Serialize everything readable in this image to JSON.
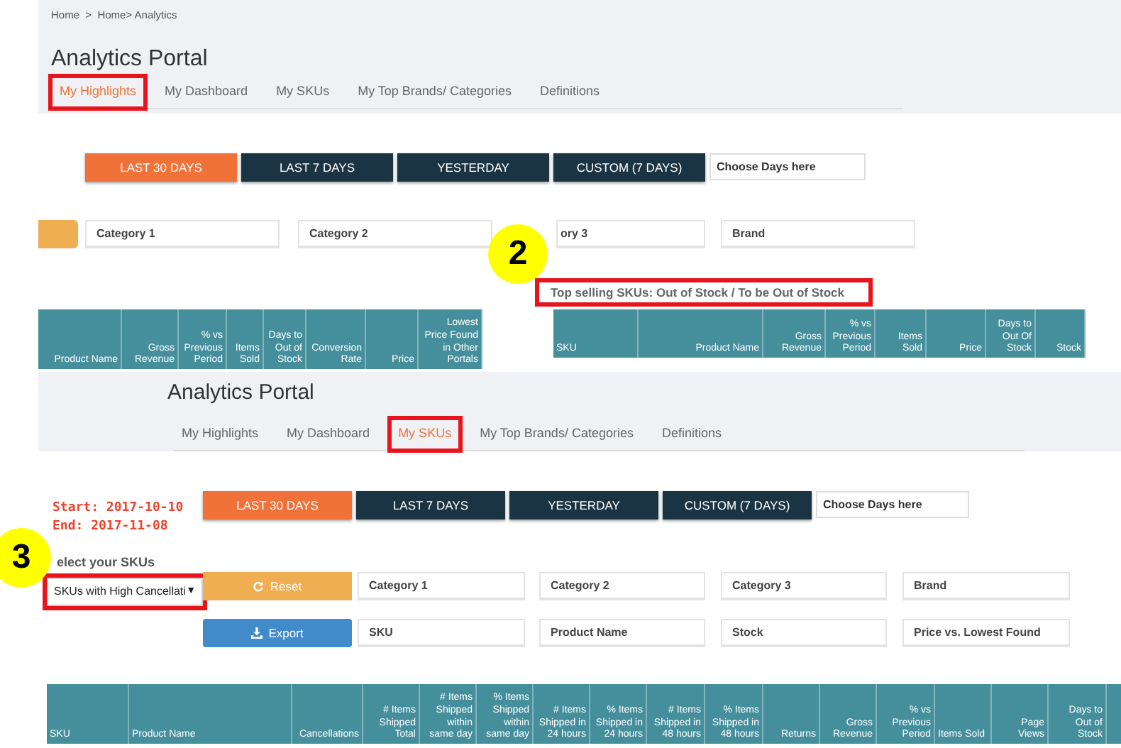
{
  "highlights_view": {
    "breadcrumb": "Home  >  Home> Analytics",
    "title": "Analytics Portal",
    "tabs": [
      {
        "label": "My Highlights",
        "selected": true,
        "annotated": true
      },
      {
        "label": "My Dashboard",
        "selected": false,
        "annotated": false
      },
      {
        "label": "My SKUs",
        "selected": false,
        "annotated": false
      },
      {
        "label": "My Top Brands/ Categories",
        "selected": false,
        "annotated": false
      },
      {
        "label": "Definitions",
        "selected": false,
        "annotated": false
      }
    ],
    "period_buttons": [
      {
        "label": "LAST 30 DAYS",
        "selected": true
      },
      {
        "label": "LAST 7 DAYS",
        "selected": false
      },
      {
        "label": "YESTERDAY",
        "selected": false
      },
      {
        "label": "CUSTOM (7 DAYS)",
        "selected": false
      }
    ],
    "days_field": {
      "placeholder": "Choose Days here"
    },
    "filters": [
      "Category 1",
      "Category 2",
      "ory 3",
      "Brand"
    ],
    "section_heading": {
      "text": "Top selling SKUs: Out of Stock / To be Out of Stock",
      "annotated": true
    },
    "table_left": {
      "columns": [
        "Product Name",
        "Gross Revenue",
        "% vs Previous Period",
        "Items Sold",
        "Days to Out of Stock",
        "Conversion Rate",
        "Price",
        "Lowest Price Found in Other Portals"
      ]
    },
    "table_right": {
      "columns": [
        "SKU",
        "Product Name",
        "Gross Revenue",
        "% vs Previous Period",
        "Items Sold",
        "Price",
        "Days to Out Of Stock",
        "Stock"
      ]
    }
  },
  "skus_view": {
    "title": "Analytics Portal",
    "tabs": [
      {
        "label": "My Highlights",
        "selected": false,
        "annotated": false
      },
      {
        "label": "My Dashboard",
        "selected": false,
        "annotated": false
      },
      {
        "label": "My SKUs",
        "selected": true,
        "annotated": true
      },
      {
        "label": "My Top Brands/ Categories",
        "selected": false,
        "annotated": false
      },
      {
        "label": "Definitions",
        "selected": false,
        "annotated": false
      }
    ],
    "date_range": [
      "Start: 2017-10-10",
      "End: 2017-11-08"
    ],
    "period_buttons": [
      {
        "label": "LAST 30 DAYS",
        "selected": true
      },
      {
        "label": "LAST 7 DAYS",
        "selected": false
      },
      {
        "label": "YESTERDAY",
        "selected": false
      },
      {
        "label": "CUSTOM (7 DAYS)",
        "selected": false
      }
    ],
    "days_field": {
      "placeholder": "Choose Days here"
    },
    "sku_select": {
      "label": "elect your SKUs",
      "value": "SKUs with High Cancellati",
      "caret": "▼",
      "annotated": true
    },
    "reset_button": {
      "label": "Reset"
    },
    "filters": [
      "Category 1",
      "Category 2",
      "Category 3",
      "Brand"
    ],
    "export_button": {
      "label": "Export"
    },
    "search_fields": [
      "SKU",
      "Product Name",
      "Stock",
      "Price vs. Lowest Found"
    ],
    "table": {
      "columns": [
        "SKU",
        "Product Name",
        "Cancellations",
        "# Items Shipped Total",
        "# Items Shipped within same day",
        "% Items Shipped within same day",
        "# Items Shipped in 24 hours",
        "% Items Shipped in 24 hours",
        "# Items Shipped in 48 hours",
        "% Items Shipped in 48 hours",
        "Returns",
        "Gross Revenue",
        "% vs Previous Period",
        "Items Sold",
        "Page Views",
        "Days to Out of Stock"
      ]
    }
  },
  "markers": [
    {
      "label": "2"
    },
    {
      "label": "3"
    }
  ]
}
